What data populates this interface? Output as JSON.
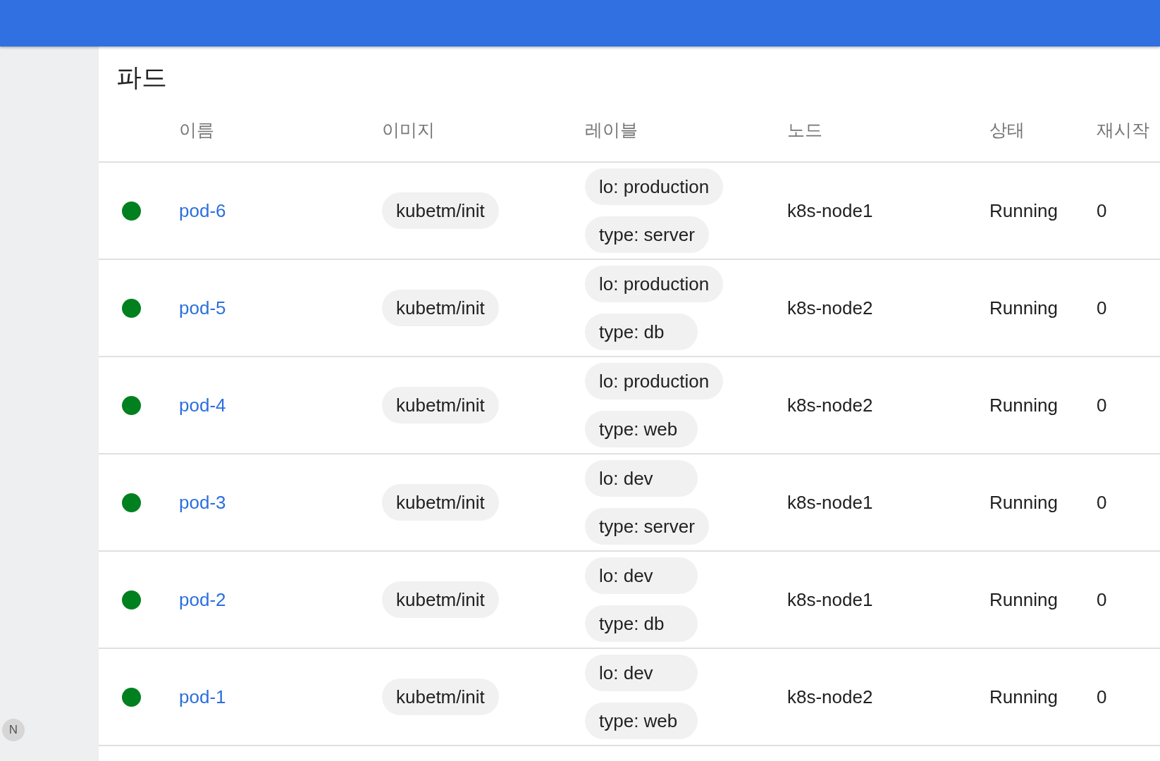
{
  "sidebar": {
    "avatar": "N"
  },
  "page": {
    "title": "파드"
  },
  "table": {
    "columns": [
      "이름",
      "이미지",
      "레이블",
      "노드",
      "상태",
      "재시작"
    ],
    "rows": [
      {
        "color": "#00801e",
        "name": "pod-6",
        "image": "kubetm/init",
        "labels": [
          "lo: production",
          "type: server"
        ],
        "node": "k8s-node1",
        "status": "Running",
        "restarts": "0"
      },
      {
        "color": "#00801e",
        "name": "pod-5",
        "image": "kubetm/init",
        "labels": [
          "lo: production",
          "type: db"
        ],
        "node": "k8s-node2",
        "status": "Running",
        "restarts": "0"
      },
      {
        "color": "#00801e",
        "name": "pod-4",
        "image": "kubetm/init",
        "labels": [
          "lo: production",
          "type: web"
        ],
        "node": "k8s-node2",
        "status": "Running",
        "restarts": "0"
      },
      {
        "color": "#00801e",
        "name": "pod-3",
        "image": "kubetm/init",
        "labels": [
          "lo: dev",
          "type: server"
        ],
        "node": "k8s-node1",
        "status": "Running",
        "restarts": "0"
      },
      {
        "color": "#00801e",
        "name": "pod-2",
        "image": "kubetm/init",
        "labels": [
          "lo: dev",
          "type: db"
        ],
        "node": "k8s-node1",
        "status": "Running",
        "restarts": "0"
      },
      {
        "color": "#00801e",
        "name": "pod-1",
        "image": "kubetm/init",
        "labels": [
          "lo: dev",
          "type: web"
        ],
        "node": "k8s-node2",
        "status": "Running",
        "restarts": "0"
      }
    ]
  }
}
